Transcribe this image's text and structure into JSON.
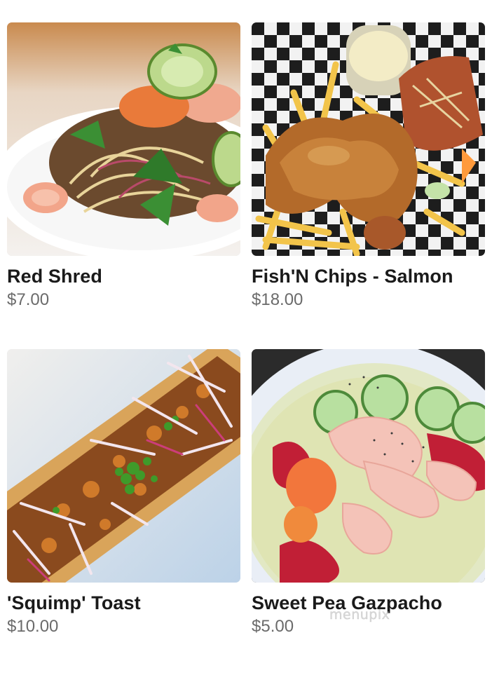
{
  "menu": {
    "items": [
      {
        "name": "Red Shred",
        "price": "$7.00",
        "image": "salad-with-shrimp"
      },
      {
        "name": "Fish'N Chips - Salmon",
        "price": "$18.00",
        "image": "fish-and-chips"
      },
      {
        "name": "'Squimp' Toast",
        "price": "$10.00",
        "image": "shrimp-toast"
      },
      {
        "name": "Sweet Pea Gazpacho",
        "price": "$5.00",
        "image": "green-soup-with-shrimp"
      }
    ]
  },
  "watermark": "menupix",
  "colors": {
    "title": "#1a1a1a",
    "price": "#6b6b6b",
    "background": "#ffffff"
  }
}
